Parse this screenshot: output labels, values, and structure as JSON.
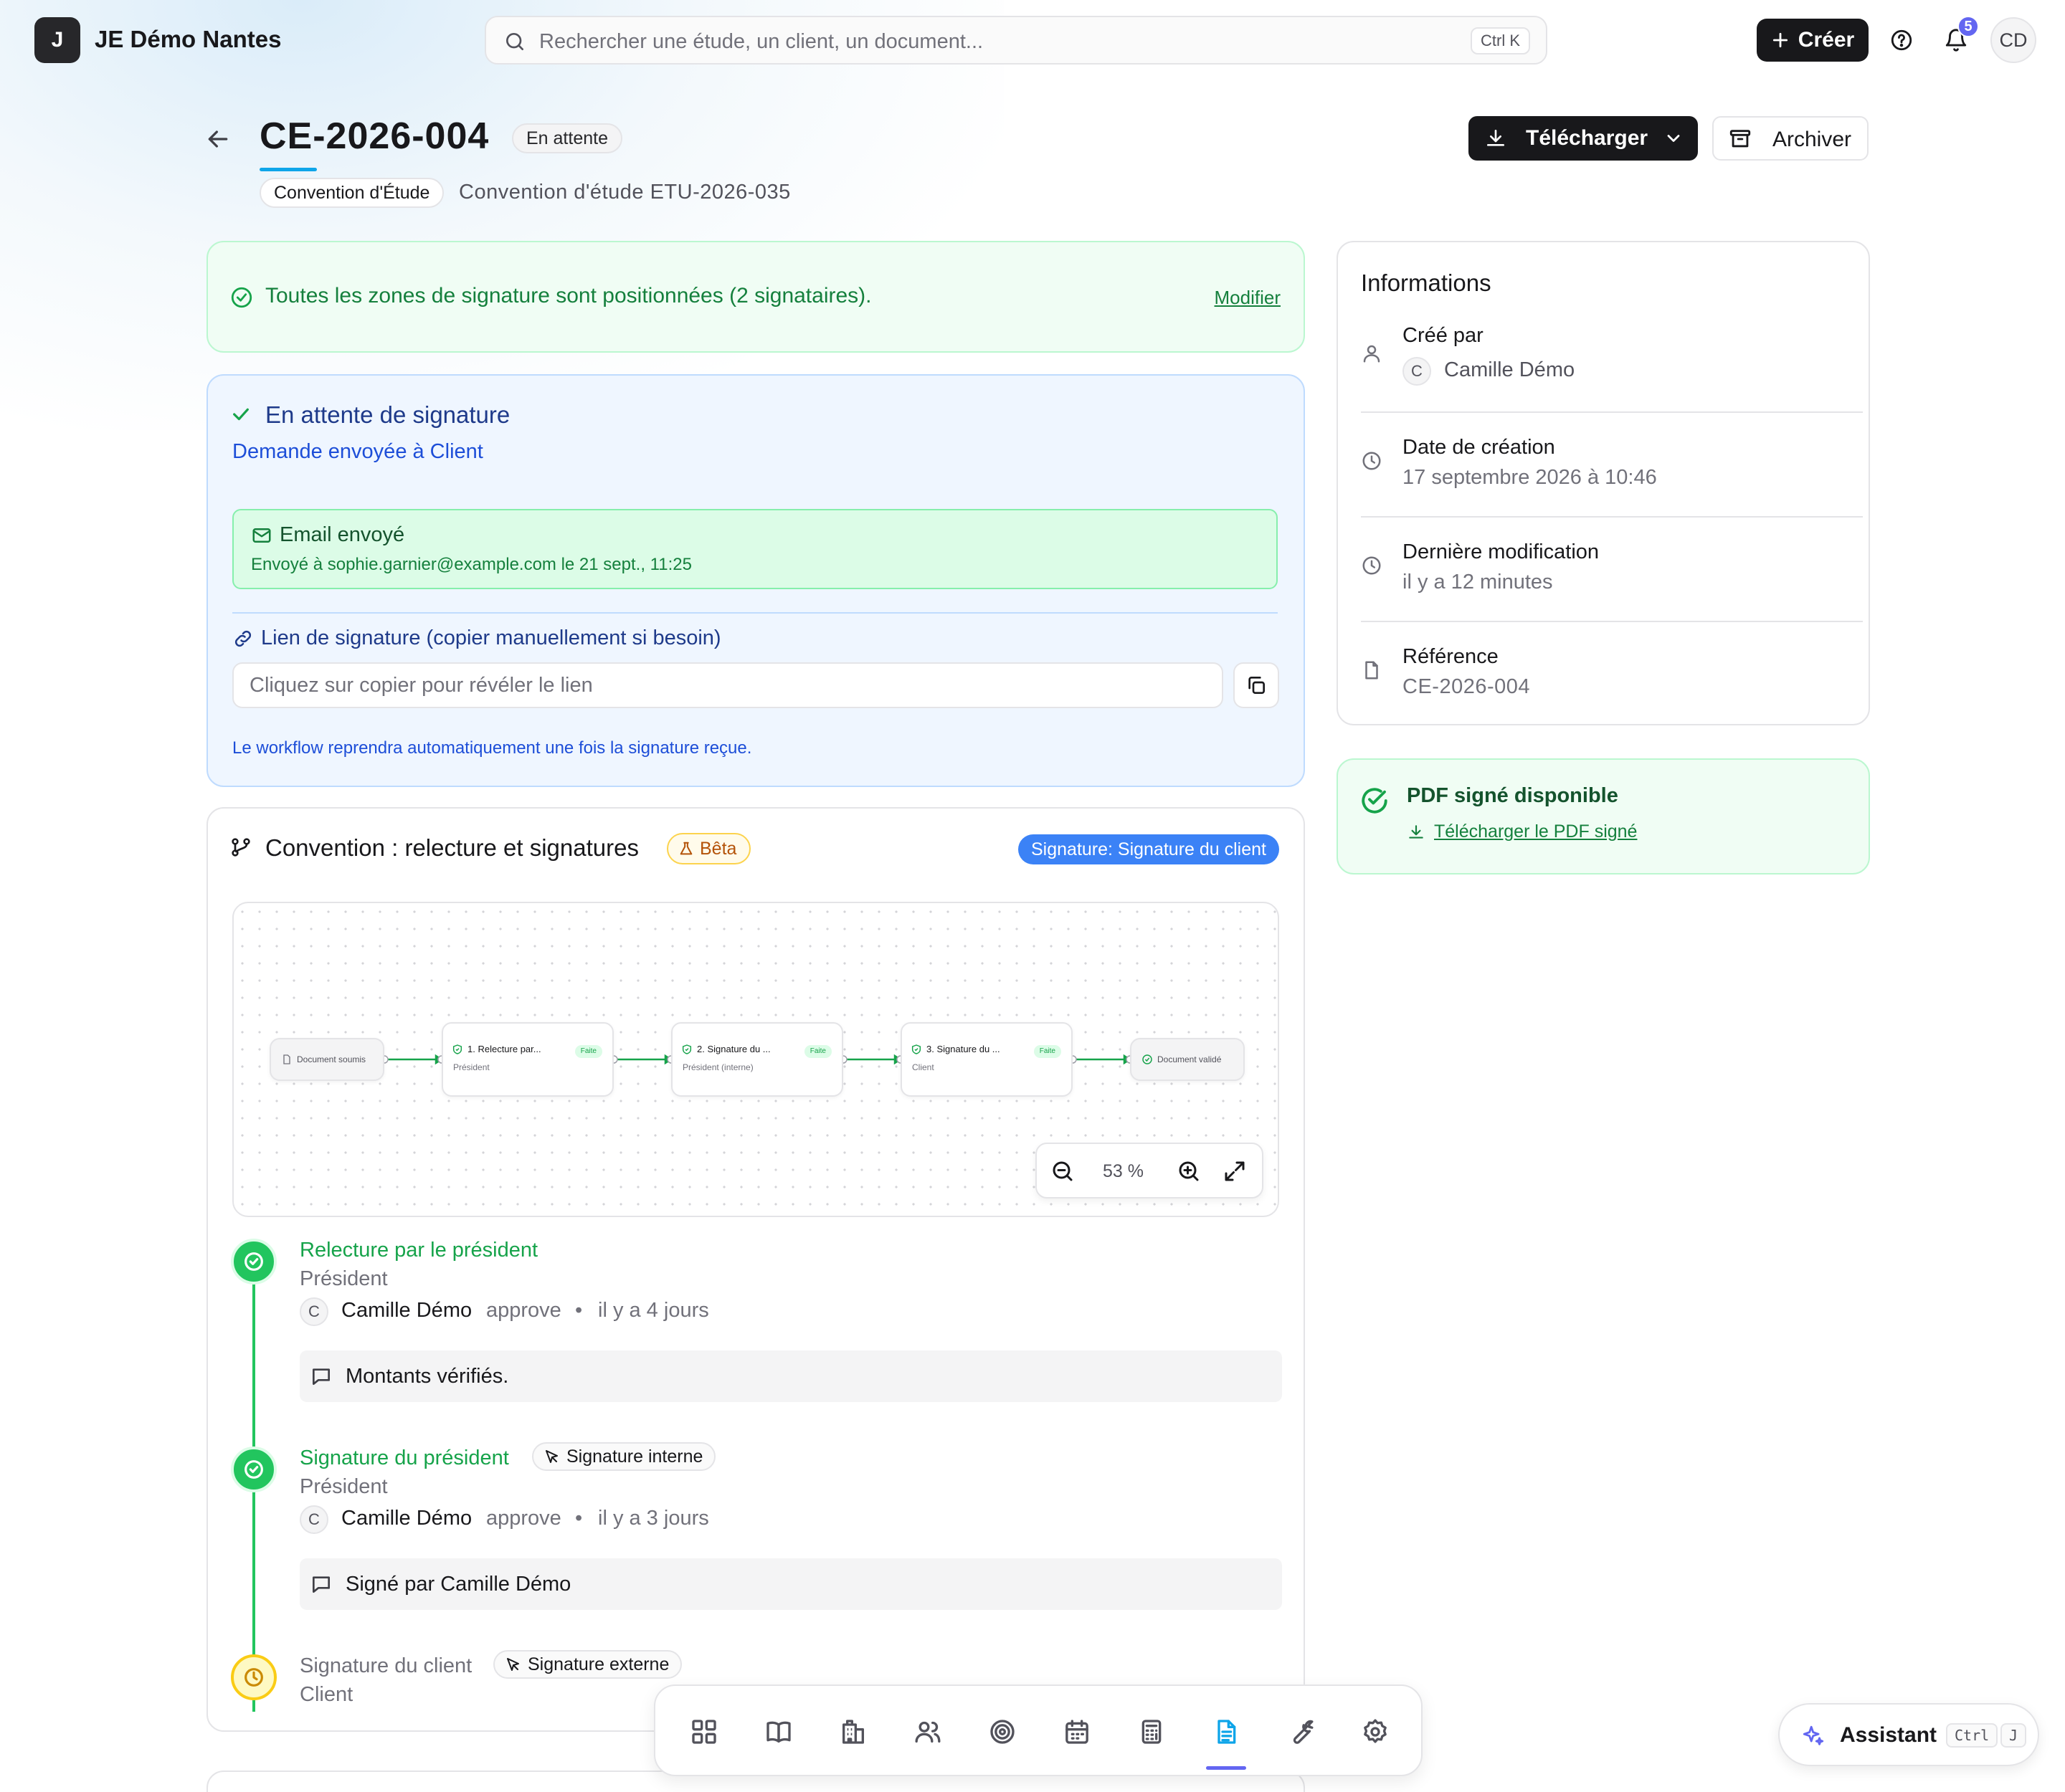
{
  "app": {
    "logo_letter": "J",
    "name": "JE Démo Nantes"
  },
  "search": {
    "placeholder": "Rechercher une étude, un client, un document...",
    "shortcut": "Ctrl K"
  },
  "topbar": {
    "create_label": "Créer",
    "notification_count": "5",
    "user_initials": "CD"
  },
  "header": {
    "title": "CE-2026-004",
    "status": "En attente",
    "doc_type": "Convention d'Étude",
    "subtitle": "Convention d'étude ETU-2026-035",
    "download_label": "Télécharger",
    "archive_label": "Archiver"
  },
  "zones_banner": {
    "text": "Toutes les zones de signature sont positionnées (2 signataires).",
    "link": "Modifier"
  },
  "pending": {
    "title": "En attente de signature",
    "subtitle": "Demande envoyée à Client",
    "email_title": "Email envoyé",
    "email_detail": "Envoyé à sophie.garnier@example.com le 21 sept., 11:25",
    "link_title": "Lien de signature (copier manuellement si besoin)",
    "link_placeholder": "Cliquez sur copier pour révéler le lien",
    "footer": "Le workflow reprendra automatiquement une fois la signature reçue."
  },
  "workflow": {
    "title": "Convention : relecture et signatures",
    "beta": "Bêta",
    "current_step": "Signature: Signature du client",
    "zoom": "53 %",
    "nodes": [
      {
        "title": "Document soumis"
      },
      {
        "title": "1. Relecture par...",
        "subtitle": "Président",
        "badge": "Faite"
      },
      {
        "title": "2. Signature du ...",
        "subtitle": "Président (interne)",
        "badge": "Faite"
      },
      {
        "title": "3. Signature du ...",
        "subtitle": "Client",
        "badge": "Faite"
      },
      {
        "title": "Document validé"
      }
    ]
  },
  "timeline": [
    {
      "title": "Relecture par le président",
      "role": "Président",
      "avatar": "C",
      "actor": "Camille Démo",
      "action": "approve",
      "sep": "•",
      "when": "il y a 4 jours",
      "comment": "Montants vérifiés."
    },
    {
      "title": "Signature du président",
      "tag": "Signature interne",
      "role": "Président",
      "avatar": "C",
      "actor": "Camille Démo",
      "action": "approve",
      "sep": "•",
      "when": "il y a 3 jours",
      "comment": "Signé par Camille Démo"
    },
    {
      "title": "Signature du client",
      "tag": "Signature externe",
      "role": "Client"
    }
  ],
  "info": {
    "title": "Informations",
    "created_by_label": "Créé par",
    "created_by_avatar": "C",
    "created_by": "Camille Démo",
    "created_date_label": "Date de création",
    "created_date": "17 septembre 2026 à 10:46",
    "modified_label": "Dernière modification",
    "modified": "il y a 12 minutes",
    "reference_label": "Référence",
    "reference": "CE-2026-004"
  },
  "signed_pdf": {
    "title": "PDF signé disponible",
    "link": "Télécharger le PDF signé"
  },
  "dock": {
    "items": [
      "dashboard-icon",
      "book-icon",
      "building-icon",
      "users-icon",
      "target-icon",
      "calendar-icon",
      "calculator-icon",
      "document-icon",
      "wrench-icon",
      "settings-icon"
    ],
    "active": "document-icon"
  },
  "assistant": {
    "label": "Assistant",
    "kbd1": "Ctrl",
    "kbd2": "J"
  },
  "colors": {
    "accent": "#18181b",
    "success": "#22c55e",
    "info_blue": "#3b82f6",
    "warning": "#facc15",
    "dock_active": "#6366f1"
  }
}
